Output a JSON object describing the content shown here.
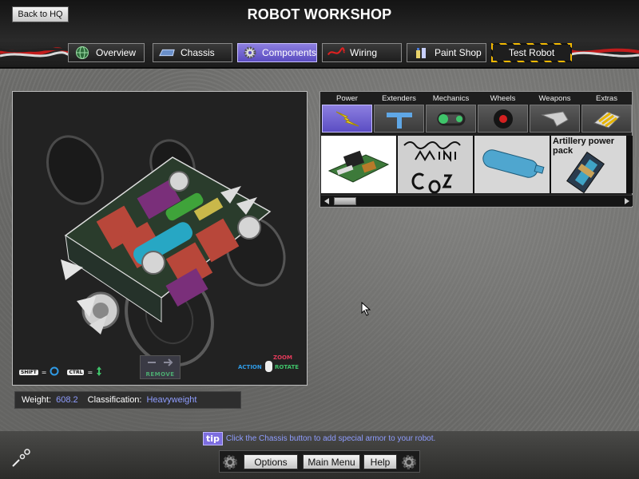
{
  "header": {
    "back_label": "Back to HQ",
    "title": "ROBOT WORKSHOP"
  },
  "nav": {
    "tabs": [
      {
        "label": "Overview",
        "icon": "globe-icon"
      },
      {
        "label": "Chassis",
        "icon": "chassis-icon"
      },
      {
        "label": "Components",
        "icon": "gear-icon",
        "active": true
      },
      {
        "label": "Wiring",
        "icon": "wire-icon"
      },
      {
        "label": "Paint Shop",
        "icon": "paint-icon"
      },
      {
        "label": "Test Robot",
        "icon": "hazard-stripes"
      }
    ]
  },
  "viewport": {
    "shift_key": "SHIFT",
    "ctrl_key": "CTRL",
    "remove_label": "REMOVE",
    "mouse_action": "ACTION",
    "mouse_zoom": "ZOOM",
    "mouse_rotate": "ROTATE"
  },
  "stats": {
    "weight_label": "Weight:",
    "weight_value": "608.2",
    "class_label": "Classification:",
    "class_value": "Heavyweight"
  },
  "components": {
    "categories": [
      {
        "label": "Power",
        "icon": "lightning-icon",
        "active": true
      },
      {
        "label": "Extenders",
        "icon": "extender-icon"
      },
      {
        "label": "Mechanics",
        "icon": "chain-drive-icon"
      },
      {
        "label": "Wheels",
        "icon": "wheel-icon"
      },
      {
        "label": "Weapons",
        "icon": "blade-icon"
      },
      {
        "label": "Extras",
        "icon": "armor-plate-icon"
      }
    ],
    "parts": [
      {
        "label": "",
        "icon": "circuit-board-icon"
      },
      {
        "label": "",
        "icon": "mini-co2-logo"
      },
      {
        "label": "",
        "icon": "co2-tank-icon"
      },
      {
        "label": "Artillery power pack",
        "icon": "power-pack-icon"
      }
    ]
  },
  "tip": {
    "badge": "tip",
    "text": "Click the Chassis button to add special armor to your robot."
  },
  "footer": {
    "options_label": "Options",
    "main_menu_label": "Main Menu",
    "help_label": "Help"
  }
}
